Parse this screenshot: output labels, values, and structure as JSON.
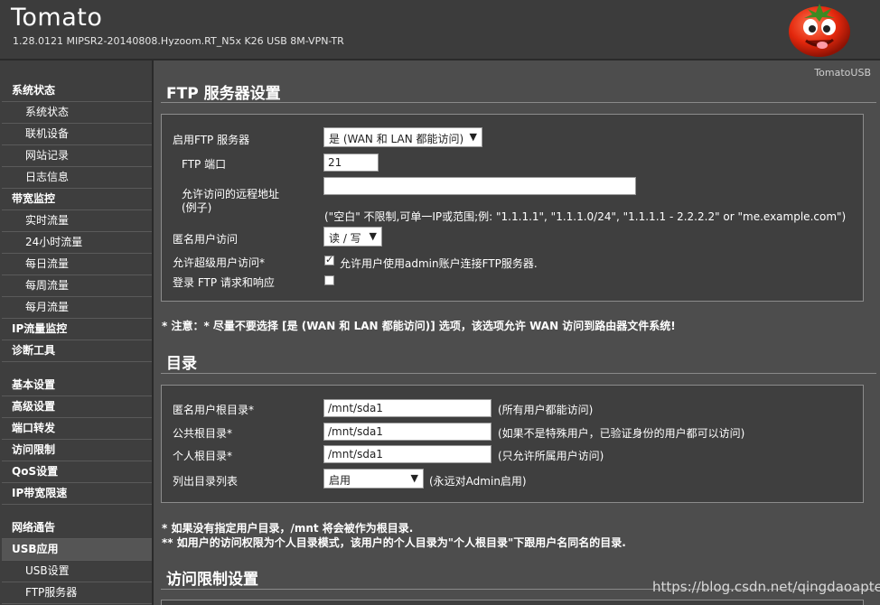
{
  "header": {
    "title": "Tomato",
    "version": "1.28.0121 MIPSR2-20140808.Hyzoom.RT_N5x K26 USB 8M-VPN-TR",
    "brand": "TomatoUSB"
  },
  "sidebar": {
    "items": [
      {
        "label": "系统状态",
        "kind": "main"
      },
      {
        "label": "系统状态",
        "kind": "sub"
      },
      {
        "label": "联机设备",
        "kind": "sub"
      },
      {
        "label": "网站记录",
        "kind": "sub"
      },
      {
        "label": "日志信息",
        "kind": "sub"
      },
      {
        "label": "带宽监控",
        "kind": "main"
      },
      {
        "label": "实时流量",
        "kind": "sub"
      },
      {
        "label": "24小时流量",
        "kind": "sub"
      },
      {
        "label": "每日流量",
        "kind": "sub"
      },
      {
        "label": "每周流量",
        "kind": "sub"
      },
      {
        "label": "每月流量",
        "kind": "sub"
      },
      {
        "label": "IP流量监控",
        "kind": "main"
      },
      {
        "label": "诊断工具",
        "kind": "main"
      },
      {
        "label": "基本设置",
        "kind": "main"
      },
      {
        "label": "高级设置",
        "kind": "main"
      },
      {
        "label": "端口转发",
        "kind": "main"
      },
      {
        "label": "访问限制",
        "kind": "main"
      },
      {
        "label": "QoS设置",
        "kind": "main"
      },
      {
        "label": "IP带宽限速",
        "kind": "main"
      },
      {
        "label": "网络通告",
        "kind": "main"
      },
      {
        "label": "USB应用",
        "kind": "main"
      },
      {
        "label": "USB设置",
        "kind": "sub"
      },
      {
        "label": "FTP服务器",
        "kind": "sub"
      }
    ]
  },
  "ftp": {
    "title": "FTP 服务器设置",
    "enable_label": "启用FTP 服务器",
    "enable_value": "是 (WAN 和 LAN 都能访问)",
    "port_label": "FTP 端口",
    "port_value": "21",
    "remote_label_1": "允许访问的远程地址",
    "remote_label_2": "(例子)",
    "remote_value": "",
    "remote_hint": "(\"空白\" 不限制,可单一IP或范围;例: \"1.1.1.1\", \"1.1.1.0/24\", \"1.1.1.1 - 2.2.2.2\" or \"me.example.com\")",
    "anon_label": "匿名用户访问",
    "anon_value": "读 / 写",
    "super_label": "允许超级用户访问*",
    "super_checked": true,
    "super_hint": "允许用户使用admin账户连接FTP服务器.",
    "log_label": "登录 FTP 请求和响应",
    "log_checked": false,
    "note": "* 注意：* 尽量不要选择 [是 (WAN 和 LAN 都能访问)] 选项，该选项允许 WAN 访问到路由器文件系统!"
  },
  "dirs": {
    "title": "目录",
    "anon_root_label": "匿名用户根目录*",
    "anon_root_value": "/mnt/sda1",
    "anon_root_hint": "(所有用户都能访问)",
    "public_root_label": "公共根目录*",
    "public_root_value": "/mnt/sda1",
    "public_root_hint": "(如果不是特殊用户，已验证身份的用户都可以访问)",
    "private_root_label": "个人根目录*",
    "private_root_value": "/mnt/sda1",
    "private_root_hint": "(只允许所属用户访问)",
    "list_label": "列出目录列表",
    "list_value": "启用",
    "list_hint": "(永远对Admin启用)",
    "note1": "*  如果没有指定用户目录，/mnt 将会被作为根目录.",
    "note2": "** 如用户的访问权限为个人目录模式，该用户的个人目录为\"个人根目录\"下跟用户名同名的目录."
  },
  "access": {
    "title": "访问限制设置"
  },
  "watermark": "https://blog.csdn.net/qingdaoaptea"
}
